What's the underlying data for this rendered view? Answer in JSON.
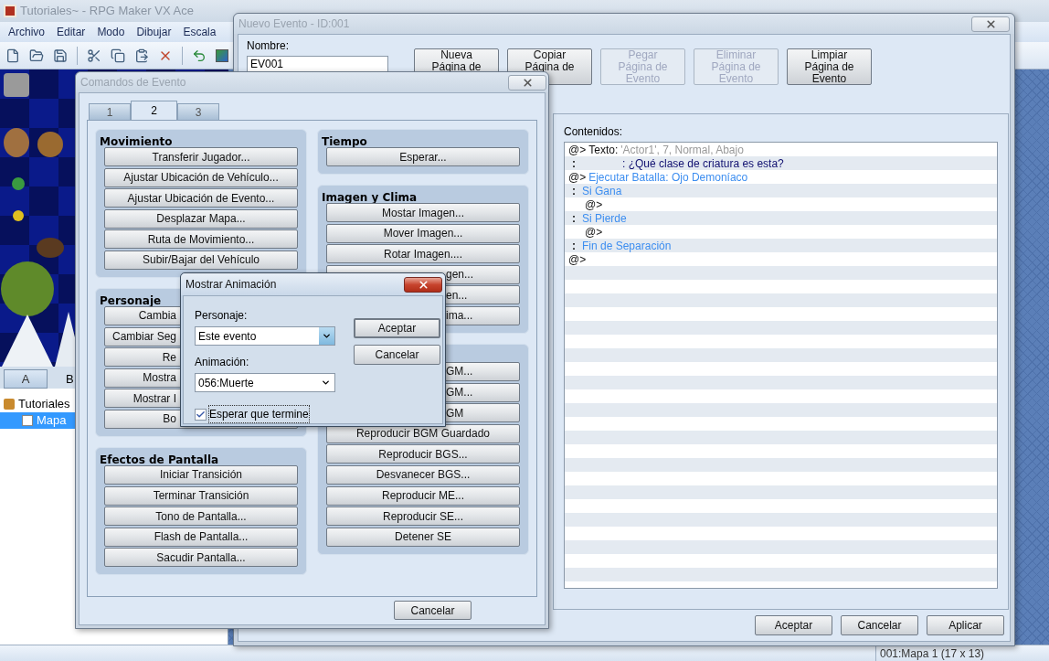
{
  "app": {
    "title": "Tutoriales~ - RPG Maker VX Ace",
    "menu": [
      "Archivo",
      "Editar",
      "Modo",
      "Dibujar",
      "Escala"
    ],
    "tileset_tabs": [
      {
        "label": "A",
        "selected": true
      },
      {
        "label": "B",
        "selected": false
      }
    ],
    "map_tree": [
      {
        "label": "Tutoriales",
        "selected": false,
        "children": [
          {
            "label": "Mapa",
            "selected": true
          }
        ]
      }
    ],
    "status_bar": "001:Mapa 1 (17 x 13)"
  },
  "event_window": {
    "title": "Nuevo Evento - ID:001",
    "name_label": "Nombre:",
    "name_value": "EV001",
    "page_buttons": [
      {
        "lines": [
          "Nueva",
          "Página de"
        ],
        "disabled": false
      },
      {
        "lines": [
          "Copiar",
          "Página de"
        ],
        "disabled": false
      },
      {
        "lines": [
          "Pegar",
          "Página de",
          "Evento"
        ],
        "disabled": true
      },
      {
        "lines": [
          "Eliminar",
          "Página de",
          "Evento"
        ],
        "disabled": true
      },
      {
        "lines": [
          "Limpiar",
          "Página de",
          "Evento"
        ],
        "disabled": false
      }
    ],
    "contents_label": "Contenidos:",
    "contents": [
      {
        "marker": "@>",
        "parts": [
          {
            "kind": "command",
            "text": "Texto:"
          },
          {
            "kind": "param",
            "text": "'Actor1', 7, Normal, Abajo"
          }
        ]
      },
      {
        "marker": ":",
        "parts": [
          {
            "kind": "message",
            "text": ": ¿Qué clase de criatura es esta?"
          }
        ]
      },
      {
        "marker": "@>",
        "parts": [
          {
            "kind": "flow",
            "text": "Ejecutar Batalla: Ojo Demoníaco"
          }
        ]
      },
      {
        "marker": ":",
        "parts": [
          {
            "kind": "flow",
            "text": "Si Gana"
          }
        ],
        "children": [
          {
            "marker": "@>"
          }
        ]
      },
      {
        "marker": ":",
        "parts": [
          {
            "kind": "flow",
            "text": "Si Pierde"
          }
        ],
        "children": [
          {
            "marker": "@>"
          }
        ]
      },
      {
        "marker": ":",
        "parts": [
          {
            "kind": "flow",
            "text": "Fin de Separación"
          }
        ]
      },
      {
        "marker": "@>"
      }
    ],
    "buttons": [
      "Aceptar",
      "Cancelar",
      "Aplicar"
    ]
  },
  "commands_window": {
    "title": "Comandos de Evento",
    "tabs": [
      {
        "label": "1",
        "selected": false
      },
      {
        "label": "2",
        "selected": true
      },
      {
        "label": "3",
        "selected": false
      }
    ],
    "columns": [
      [
        {
          "title": "Movimiento",
          "buttons": [
            {
              "kind": "full",
              "label": "Transferir Jugador..."
            },
            {
              "kind": "full",
              "label": "Ajustar Ubicación de Vehículo..."
            },
            {
              "kind": "full",
              "label": "Ajustar Ubicación de Evento..."
            },
            {
              "kind": "full",
              "label": "Desplazar Mapa..."
            },
            {
              "kind": "full",
              "label": "Ruta de Movimiento..."
            },
            {
              "kind": "full",
              "label": "Subir/Bajar del Vehículo"
            }
          ]
        },
        {
          "title": "Personaje",
          "buttons": [
            {
              "kind": "head",
              "label": "Cambia"
            },
            {
              "kind": "head",
              "label": "Cambiar Seg"
            },
            {
              "kind": "head",
              "label": "Re"
            },
            {
              "kind": "head",
              "label": "Mostra"
            },
            {
              "kind": "head",
              "label": "Mostrar I"
            },
            {
              "kind": "head",
              "label": "Bo"
            }
          ]
        },
        {
          "title": "Efectos de Pantalla",
          "buttons": [
            {
              "kind": "full",
              "label": "Iniciar Transición"
            },
            {
              "kind": "full",
              "label": "Terminar Transición"
            },
            {
              "kind": "full",
              "label": "Tono de Pantalla..."
            },
            {
              "kind": "full",
              "label": "Flash de Pantalla..."
            },
            {
              "kind": "full",
              "label": "Sacudir Pantalla..."
            }
          ]
        }
      ],
      [
        {
          "title": "Tiempo",
          "buttons": [
            {
              "kind": "full",
              "label": "Esperar..."
            }
          ]
        },
        {
          "title": "Imagen y Clima",
          "buttons": [
            {
              "kind": "full",
              "label": "Mostar Imagen..."
            },
            {
              "kind": "full",
              "label": "Mover Imagen..."
            },
            {
              "kind": "full",
              "label": "Rotar Imagen...."
            },
            {
              "kind": "tail",
              "label": "gen..."
            },
            {
              "kind": "tail",
              "label": "en..."
            },
            {
              "kind": "tail",
              "label": "ima..."
            }
          ]
        },
        {
          "buttons": [
            {
              "kind": "tail",
              "label": "GM..."
            },
            {
              "kind": "tail",
              "label": "GM..."
            },
            {
              "kind": "tail",
              "label": "GM"
            },
            {
              "kind": "full",
              "label": "Reproducir BGM Guardado"
            },
            {
              "kind": "full",
              "label": "Reproducir BGS..."
            },
            {
              "kind": "full",
              "label": "Desvanecer BGS..."
            },
            {
              "kind": "full",
              "label": "Reproducir ME..."
            },
            {
              "kind": "full",
              "label": "Reproducir SE..."
            },
            {
              "kind": "full",
              "label": "Detener SE"
            }
          ]
        }
      ]
    ],
    "cancel": "Cancelar"
  },
  "animation_dialog": {
    "title": "Mostrar Animación",
    "character_label": "Personaje:",
    "character_value": "Este evento",
    "animation_label": "Animación:",
    "animation_value": "056:Muerte",
    "wait": {
      "label": "Esperar que termine",
      "checked": true
    },
    "buttons": [
      "Aceptar",
      "Cancelar"
    ]
  }
}
